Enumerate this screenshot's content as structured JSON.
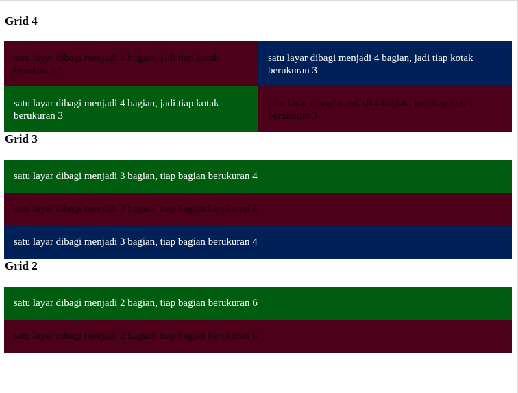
{
  "grid4": {
    "title": "Grid 4",
    "cells": [
      "satu layar dibagi menjadi 4 bagian, jadi tiap kotak berukuran 3",
      "satu layar dibagi menjadi 4 bagian, jadi tiap kotak berukuran 3",
      "satu layar dibagi menjadi 4 bagian, jadi tiap kotak berukuran 3",
      "satu layar dibagi menjadi 4 bagian, jadi tiap kotak berukuran 3"
    ]
  },
  "grid3": {
    "title": "Grid 3",
    "rows": [
      "satu layar dibagi menjadi 3 bagian, tiap bagian berukuran 4",
      "satu layar dibagi menjadi 3 bagian, tiap bagian berukuran 4",
      "satu layar dibagi menjadi 3 bagian, tiap bagian berukuran 4"
    ]
  },
  "grid2": {
    "title": "Grid 2",
    "rows": [
      "satu layar dibagi menjadi 2 bagian, tiap bagian berukuran 6",
      "satu layar dibagi menjadi 2 bagian, tiap bagian berukuran 6"
    ]
  },
  "colors": {
    "maroon": "#4d0019",
    "navy": "#002157",
    "green": "#005c0f"
  }
}
